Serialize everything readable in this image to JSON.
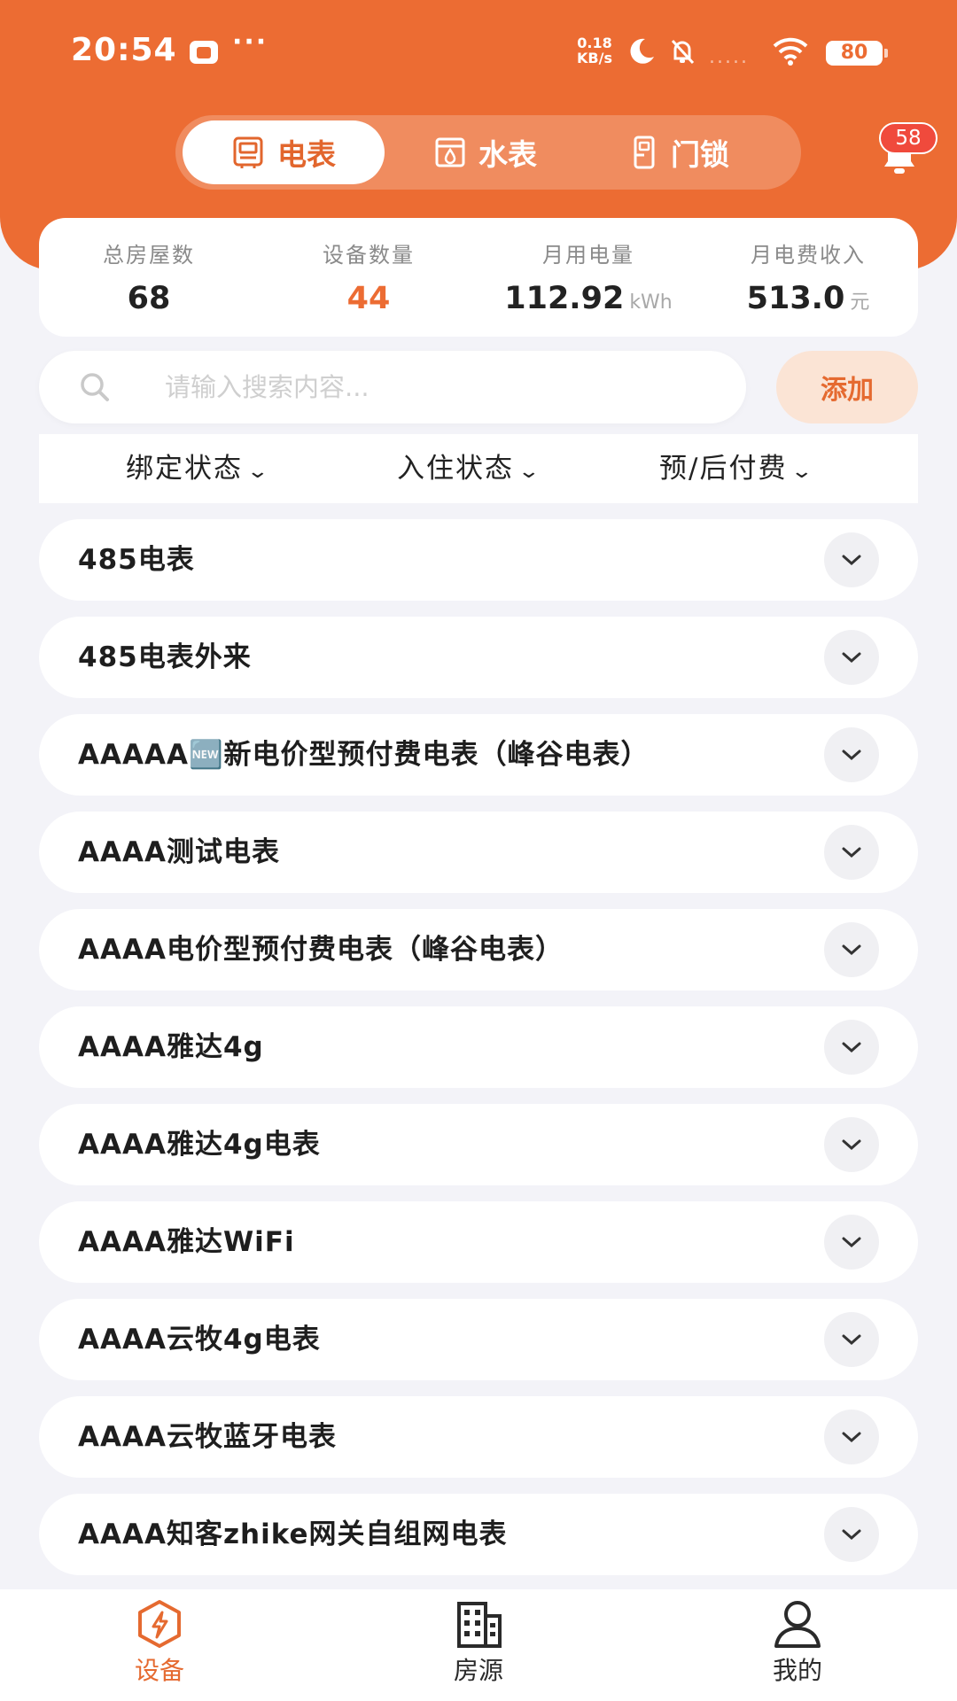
{
  "status_bar": {
    "time": "20:54",
    "more": "···",
    "speed_value": "0.18",
    "speed_unit": "KB/s",
    "signal_dots": ".....",
    "battery": "80"
  },
  "tabs": [
    {
      "label": "电表",
      "icon": "electric-meter-icon",
      "active": true
    },
    {
      "label": "水表",
      "icon": "water-meter-icon",
      "active": false
    },
    {
      "label": "门锁",
      "icon": "door-lock-icon",
      "active": false
    }
  ],
  "notifications": {
    "count": "58",
    "icon": "bell-icon"
  },
  "stats": [
    {
      "label": "总房屋数",
      "value": "68",
      "unit": ""
    },
    {
      "label": "设备数量",
      "value": "44",
      "unit": ""
    },
    {
      "label": "月用电量",
      "value": "112.92",
      "unit": "kWh"
    },
    {
      "label": "月电费收入",
      "value": "513.0",
      "unit": "元"
    }
  ],
  "search": {
    "placeholder": "请输入搜索内容...",
    "value": ""
  },
  "add_label": "添加",
  "filters": [
    {
      "label": "绑定状态"
    },
    {
      "label": "入住状态"
    },
    {
      "label": "预/后付费"
    }
  ],
  "devices": [
    {
      "name": "485电表"
    },
    {
      "name": "485电表外来"
    },
    {
      "name": "AAAAA🆕新电价型预付费电表（峰谷电表）"
    },
    {
      "name": "AAAA测试电表"
    },
    {
      "name": "AAAA电价型预付费电表（峰谷电表）"
    },
    {
      "name": "AAAA雅达4g"
    },
    {
      "name": "AAAA雅达4g电表"
    },
    {
      "name": "AAAA雅达WiFi"
    },
    {
      "name": "AAAA云牧4g电表"
    },
    {
      "name": "AAAA云牧蓝牙电表"
    },
    {
      "name": "AAAA知客zhike网关自组网电表"
    }
  ],
  "bottom_nav": [
    {
      "label": "设备",
      "icon": "device-bolt-icon",
      "active": true
    },
    {
      "label": "房源",
      "icon": "building-icon",
      "active": false
    },
    {
      "label": "我的",
      "icon": "person-icon",
      "active": false
    }
  ],
  "colors": {
    "accent": "#ec6c33",
    "badge": "#f04a3c",
    "background": "#f3f3f8"
  }
}
